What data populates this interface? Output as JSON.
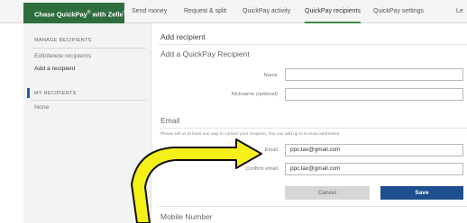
{
  "topnav": {
    "brand_main": "Chase QuickPay",
    "brand_reg1": "®",
    "brand_with": " with Zelle",
    "brand_reg2": "®",
    "items": [
      "Send money",
      "Request & split",
      "QuickPay activity",
      "QuickPay recipients",
      "QuickPay settings",
      "Le"
    ],
    "active_item": "QuickPay recipients"
  },
  "sidebar": {
    "manage_heading": "MANAGE RECIPIENTS",
    "manage_items": [
      "Edit/delete recipients",
      "Add a recipient"
    ],
    "active_item": "Add a recipient",
    "my_heading": "MY RECIPIENTS",
    "my_items": [
      "None"
    ]
  },
  "form": {
    "page_title": "Add recipient",
    "section_title": "Add a QuickPay Recipient",
    "name_label": "Name",
    "name_value": "",
    "nickname_label": "Nickname (optional)",
    "nickname_value": "",
    "email_section": "Email",
    "email_hint": "Please tell us at least one way to contact your recipient. You can add up to 5 email addresses.",
    "email_label": "Email",
    "email_value": "ppc.tax@gmail.com",
    "confirm_label": "Confirm email",
    "confirm_value": "ppc.tax@gmail.com",
    "cancel_label": "Cancel",
    "save_label": "Save",
    "mobile_section": "Mobile Number"
  },
  "colors": {
    "brand_green": "#2e6e3c",
    "save_blue": "#1e4f8e",
    "sidebar_active_bar": "#1f5ea8",
    "annotation_arrow_fill": "#f5ef1a",
    "annotation_arrow_stroke": "#111111"
  }
}
